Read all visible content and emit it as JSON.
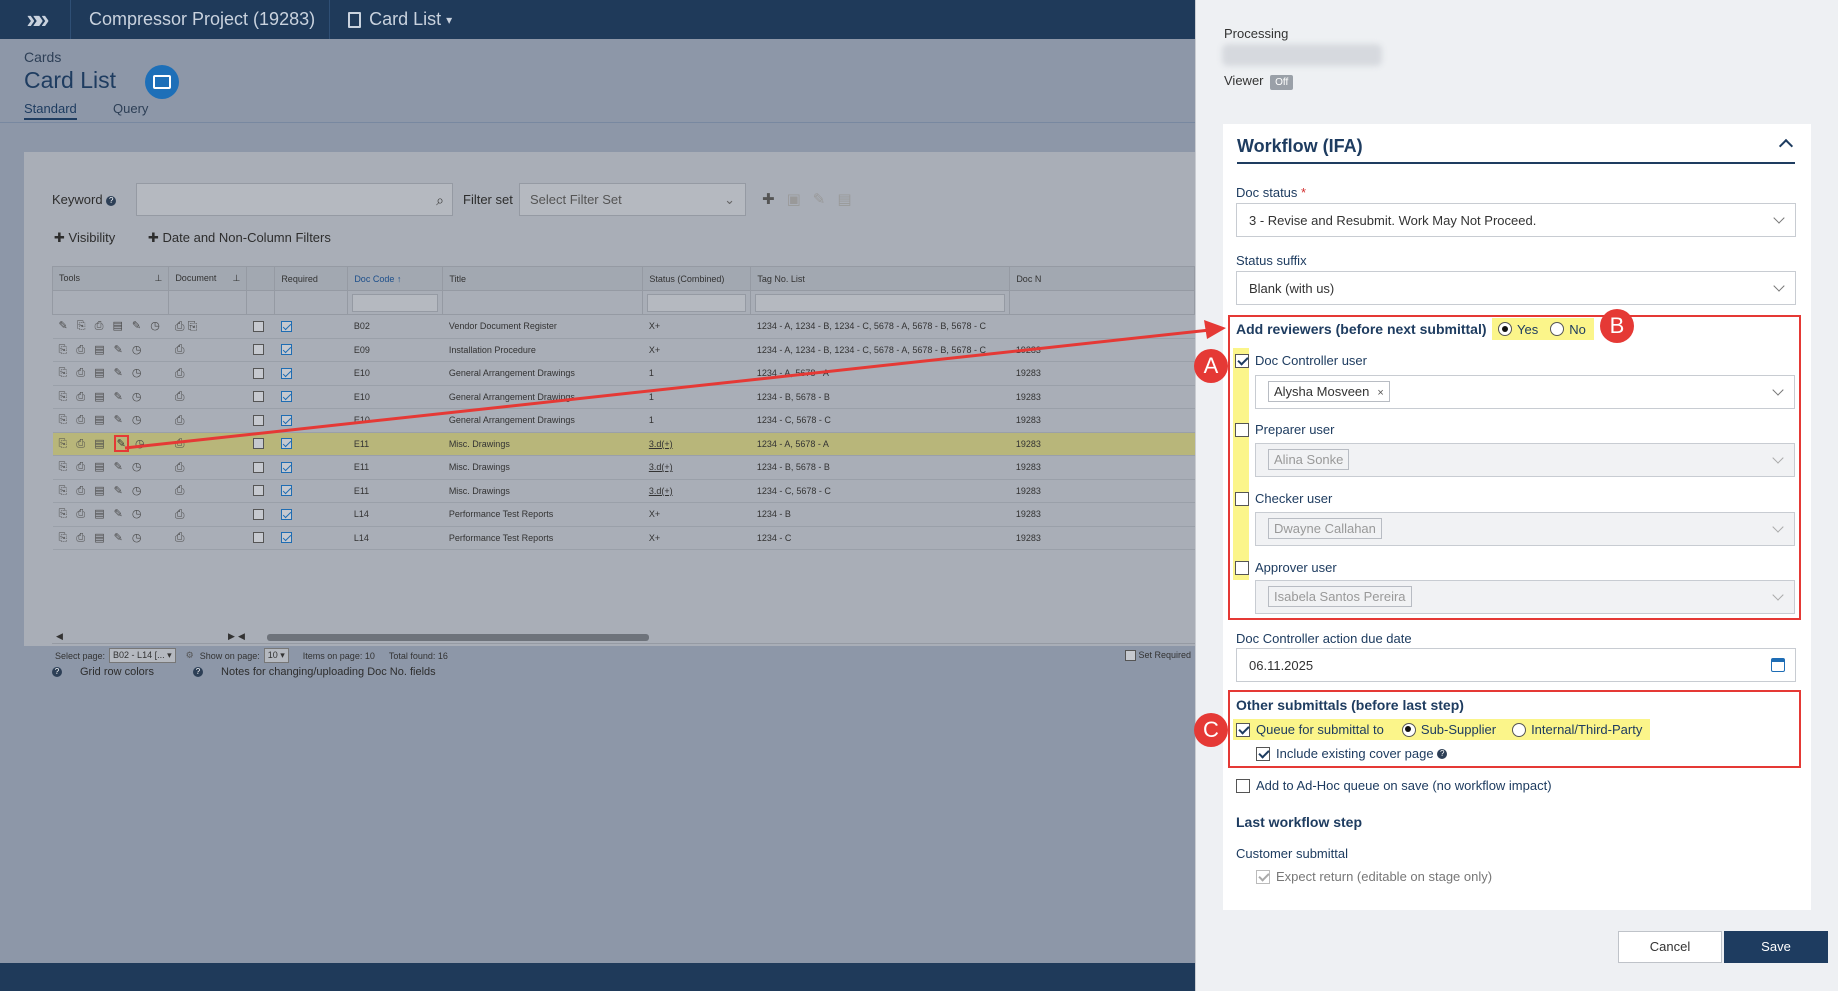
{
  "topbar": {
    "project": "Compressor Project (19283)",
    "view": "Card List"
  },
  "header": {
    "section": "Cards",
    "title": "Card List",
    "tabs": [
      "Standard",
      "Query"
    ]
  },
  "filters": {
    "keyword_label": "Keyword",
    "filterset_label": "Filter set",
    "filterset_placeholder": "Select Filter Set",
    "visibility": "Visibility",
    "date_filters": "Date and Non-Column Filters"
  },
  "grid": {
    "columns": [
      "Tools",
      "Document",
      "",
      "Required",
      "Doc Code",
      "Title",
      "Status (Combined)",
      "Tag No. List",
      "Doc N"
    ],
    "rows": [
      {
        "code": "B02",
        "title": "Vendor Document Register",
        "status": "X+",
        "tags": "1234 - A, 1234 - B, 1234 - C, 5678 - A, 5678 - B, 5678 - C",
        "docno": ""
      },
      {
        "code": "E09",
        "title": "Installation Procedure",
        "status": "X+",
        "tags": "1234 - A, 1234 - B, 1234 - C, 5678 - A, 5678 - B, 5678 - C",
        "docno": "19283"
      },
      {
        "code": "E10",
        "title": "General Arrangement Drawings",
        "status": "1",
        "tags": "1234 - A, 5678 - A",
        "docno": "19283"
      },
      {
        "code": "E10",
        "title": "General Arrangement Drawings",
        "status": "1",
        "tags": "1234 - B, 5678 - B",
        "docno": "19283"
      },
      {
        "code": "E10",
        "title": "General Arrangement Drawings",
        "status": "1",
        "tags": "1234 - C, 5678 - C",
        "docno": "19283"
      },
      {
        "code": "E11",
        "title": "Misc. Drawings",
        "status": "3.d(+)",
        "tags": "1234 - A, 5678 - A",
        "docno": "19283"
      },
      {
        "code": "E11",
        "title": "Misc. Drawings",
        "status": "3.d(+)",
        "tags": "1234 - B, 5678 - B",
        "docno": "19283"
      },
      {
        "code": "E11",
        "title": "Misc. Drawings",
        "status": "3.d(+)",
        "tags": "1234 - C, 5678 - C",
        "docno": "19283"
      },
      {
        "code": "L14",
        "title": "Performance Test Reports",
        "status": "X+",
        "tags": "1234 - B",
        "docno": "19283"
      },
      {
        "code": "L14",
        "title": "Performance Test Reports",
        "status": "X+",
        "tags": "1234 - C",
        "docno": "19283"
      }
    ],
    "pager": {
      "select_page_label": "Select page:",
      "select_page_value": "B02 - L14 [...",
      "show_label": "Show on page:",
      "show_value": "10",
      "items_on_page": "Items on page: 10",
      "total_found": "Total found: 16",
      "set_required": "Set Required"
    },
    "footer_links": [
      "Grid row colors",
      "Notes for changing/uploading Doc No. fields"
    ]
  },
  "drawer": {
    "processing_label": "Processing",
    "viewer_label": "Viewer",
    "viewer_state": "Off",
    "workflow_title": "Workflow (IFA)",
    "doc_status_label": "Doc status",
    "doc_status_value": "3 - Revise and Resubmit. Work May Not Proceed.",
    "status_suffix_label": "Status suffix",
    "status_suffix_value": "Blank (with us)",
    "add_reviewers_label": "Add reviewers (before next submittal)",
    "yes": "Yes",
    "no": "No",
    "doc_controller_label": "Doc Controller user",
    "doc_controller_value": "Alysha Mosveen",
    "preparer_label": "Preparer user",
    "preparer_value": "Alina Sonke",
    "checker_label": "Checker user",
    "checker_value": "Dwayne Callahan",
    "approver_label": "Approver user",
    "approver_value": "Isabela Santos Pereira",
    "due_date_label": "Doc Controller action due date",
    "due_date_value": "06.11.2025",
    "other_submittals_label": "Other submittals (before last step)",
    "queue_label": "Queue for submittal to",
    "sub_supplier": "Sub-Supplier",
    "internal": "Internal/Third-Party",
    "include_cover": "Include existing cover page",
    "adhoc_label": "Add to Ad-Hoc queue on save (no workflow impact)",
    "last_step_title": "Last workflow step",
    "customer_submittal": "Customer submittal",
    "expect_return": "Expect return (editable on stage only)",
    "cancel": "Cancel",
    "save": "Save"
  },
  "annotations": {
    "a": "A",
    "b": "B",
    "c": "C"
  },
  "colors": {
    "accent": "#1e3c60",
    "annotation": "#e53935",
    "highlight": "#fbf58a"
  }
}
